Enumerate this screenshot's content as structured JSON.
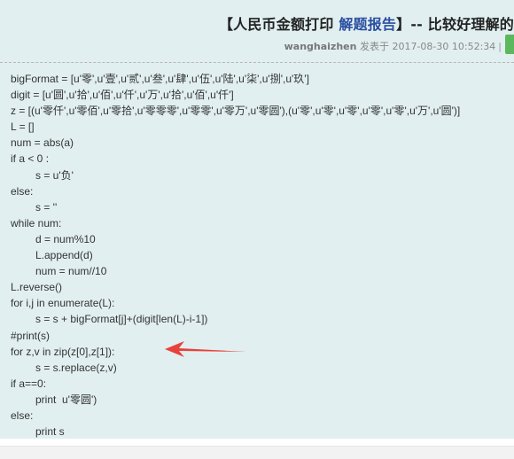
{
  "post": {
    "title_prefix": "【人民币金额打印 ",
    "title_link": "解题报告",
    "title_suffix": "】-- 比较好理解的",
    "author": "wanghaizhen",
    "posted_label": "发表于",
    "datetime": "2017-08-30 10:52:34",
    "meta_sep": "|"
  },
  "code_lines": [
    {
      "indent": 0,
      "text": "bigFormat = [u'零',u'壹',u'贰',u'叁',u'肆',u'伍',u'陆',u'柒',u'捌',u'玖']"
    },
    {
      "indent": 0,
      "text": "digit = [u'圆',u'拾',u'佰',u'仟',u'万',u'拾',u'佰',u'仟']"
    },
    {
      "indent": 0,
      "text": "z = [(u'零仟',u'零佰',u'零拾',u'零零零',u'零零',u'零万',u'零圆'),(u'零',u'零',u'零',u'零',u'零',u'万',u'圆')]"
    },
    {
      "indent": 0,
      "text": "L = []"
    },
    {
      "indent": 0,
      "text": "num = abs(a)"
    },
    {
      "indent": 0,
      "text": "if a < 0 :"
    },
    {
      "indent": 1,
      "text": "s = u'负'"
    },
    {
      "indent": 0,
      "text": "else:"
    },
    {
      "indent": 1,
      "text": "s = ''"
    },
    {
      "indent": 0,
      "text": "while num:"
    },
    {
      "indent": 1,
      "text": "d = num%10"
    },
    {
      "indent": 1,
      "text": "L.append(d)"
    },
    {
      "indent": 1,
      "text": "num = num//10"
    },
    {
      "indent": 0,
      "text": "L.reverse()"
    },
    {
      "indent": 0,
      "text": "for i,j in enumerate(L):"
    },
    {
      "indent": 1,
      "text": "s = s + bigFormat[j]+(digit[len(L)-i-1])"
    },
    {
      "indent": 0,
      "text": "#print(s)"
    },
    {
      "indent": 0,
      "text": "for z,v in zip(z[0],z[1]):"
    },
    {
      "indent": 1,
      "text": "s = s.replace(z,v)"
    },
    {
      "indent": 0,
      "text": "if a==0:"
    },
    {
      "indent": 1,
      "text": "print  u'零圆')"
    },
    {
      "indent": 0,
      "text": "else:"
    },
    {
      "indent": 1,
      "text": "print s"
    }
  ],
  "colors": {
    "card_bg": "#e1eff0",
    "link": "#2a4fa0",
    "arrow": "#e8413c",
    "button": "#5cb85c"
  }
}
